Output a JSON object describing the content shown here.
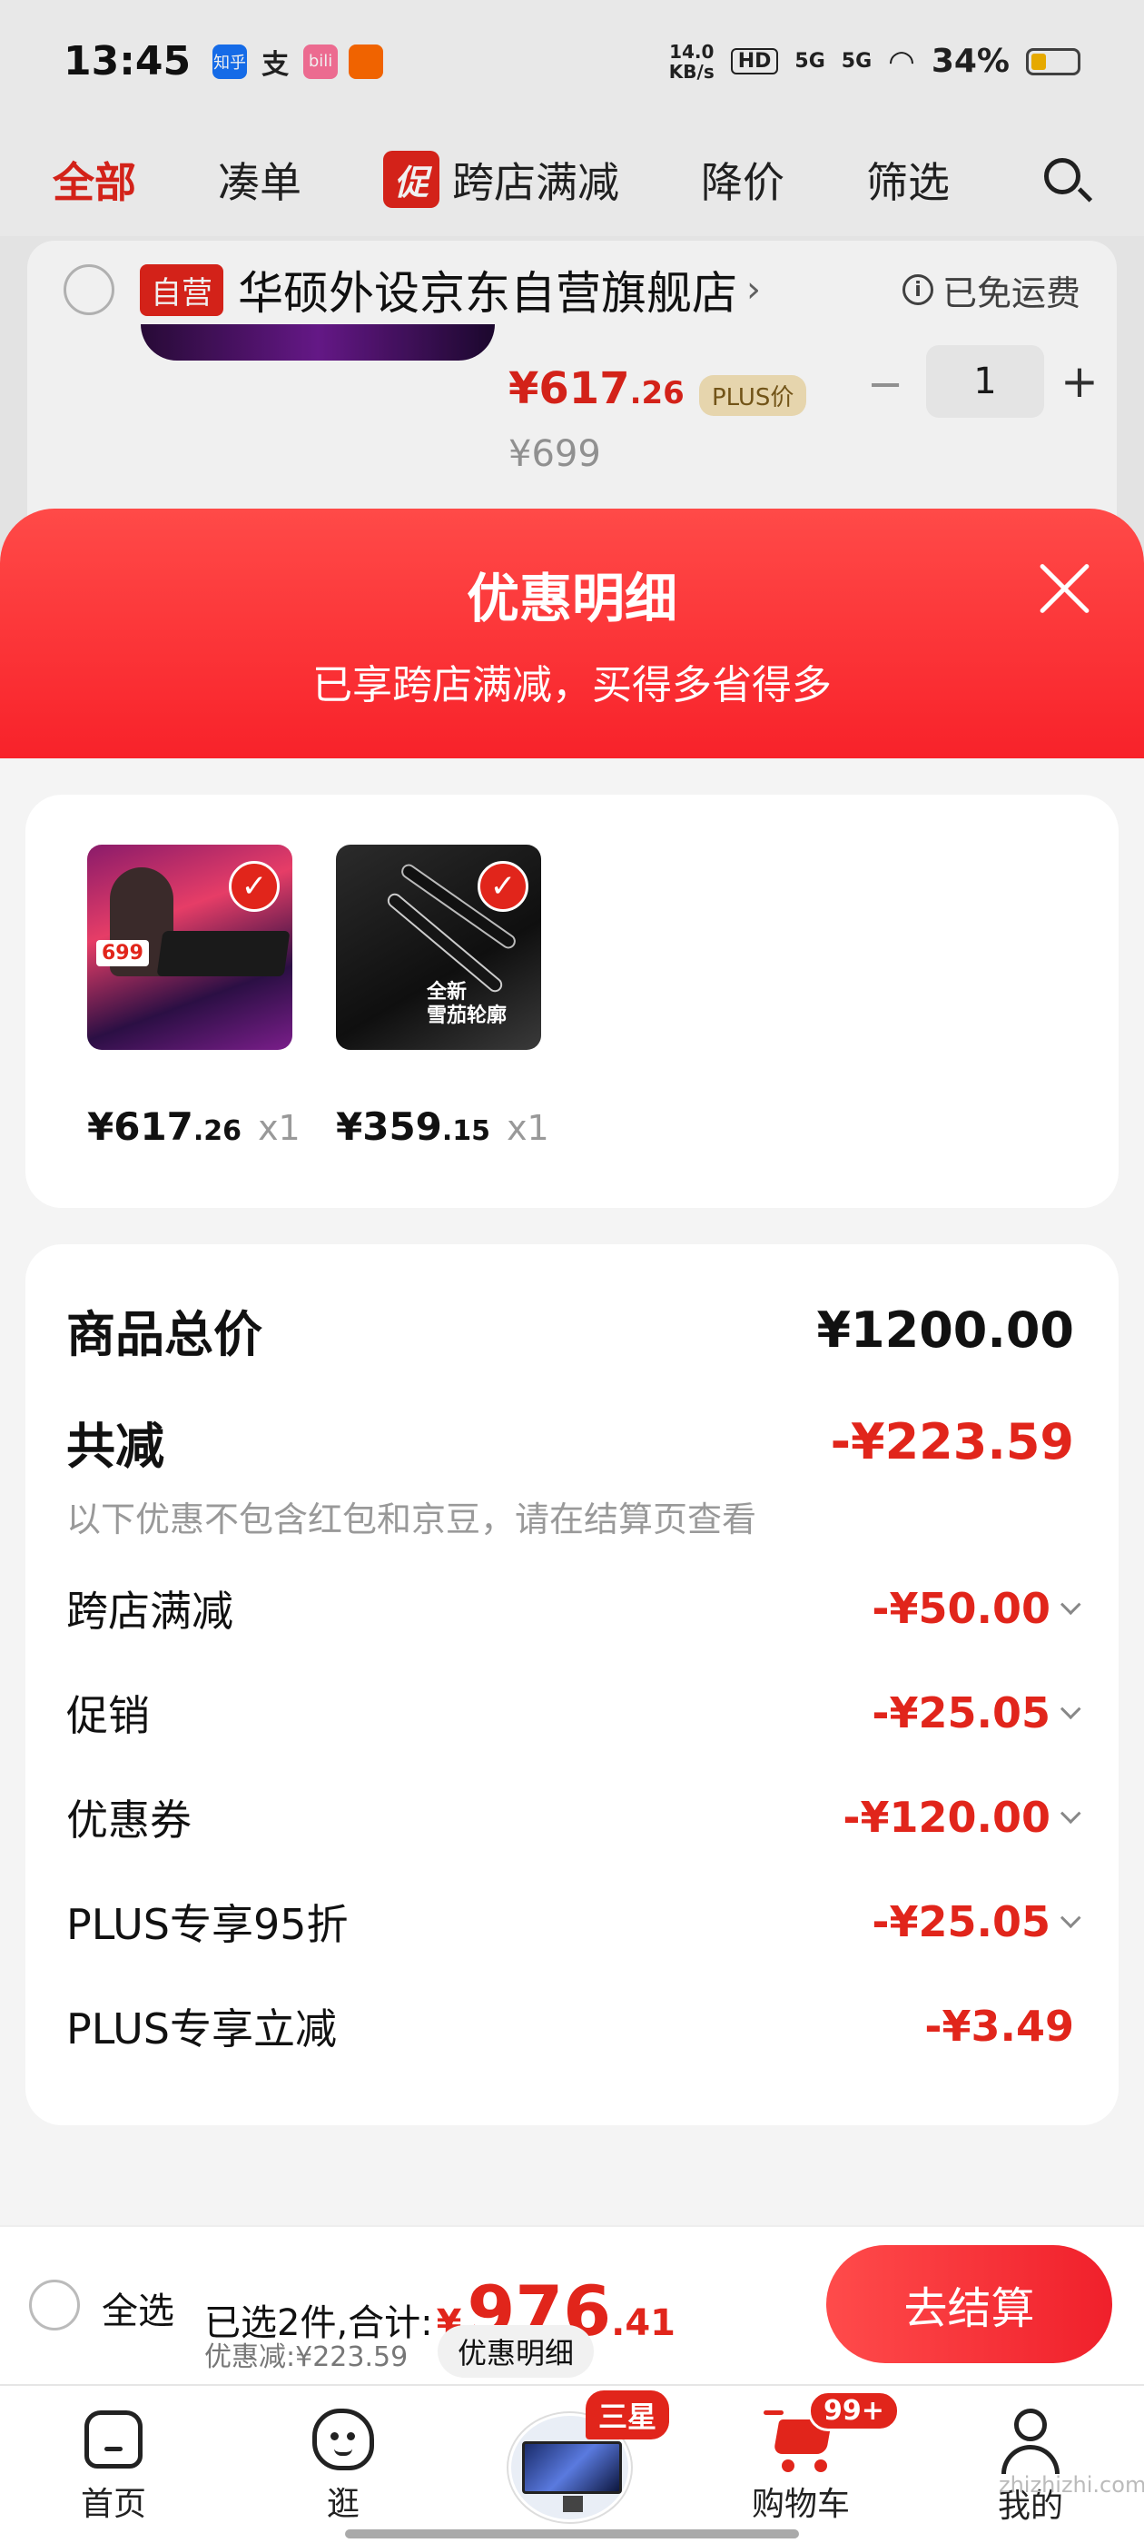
{
  "status_bar": {
    "time": "13:45",
    "apps": [
      {
        "icon": "zhihu-icon",
        "label": "知乎",
        "color": "#1772f6"
      },
      {
        "icon": "alipay-icon",
        "label": "支",
        "color": "#ffffff"
      },
      {
        "icon": "bilibili-icon",
        "label": "bili",
        "color": "#fb7299"
      },
      {
        "icon": "app-icon",
        "label": "",
        "color": "#ff6a00"
      }
    ],
    "net_speed_value": "14.0",
    "net_speed_unit": "KB/s",
    "hd_label": "HD",
    "signal1": "5G",
    "signal2": "5G",
    "battery": "34%",
    "battery_level": 0.34
  },
  "filter_bar": {
    "all": "全部",
    "bundle": "凑单",
    "promo_tag": "促",
    "cross_store": "跨店满减",
    "price_drop": "降价",
    "filter": "筛选"
  },
  "store": {
    "self_badge": "自营",
    "name": "华硕外设京东自营旗舰店",
    "chevron": "›",
    "free_shipping": "已免运费",
    "info": "i",
    "item_price_main": "¥617",
    "item_price_cents": ".26",
    "plus_badge": "PLUS价",
    "qty": "1",
    "qty_minus": "−",
    "qty_plus": "+",
    "orig_price": "¥699"
  },
  "sheet": {
    "title": "优惠明细",
    "subtitle": "已享跨店满减，买得多省得多",
    "products": [
      {
        "price_main": "¥617",
        "price_cents": ".26",
        "qty": "x1",
        "thumb_tag": "699"
      },
      {
        "price_main": "¥359",
        "price_cents": ".15",
        "qty": "x1",
        "thumb_text1": "全新",
        "thumb_text2": "雪茄轮廓"
      }
    ],
    "check_mark": "✓",
    "total_label": "商品总价",
    "total_value": "¥1200.00",
    "reduce_label": "共减",
    "reduce_value": "-¥223.59",
    "note": "以下优惠不包含红包和京豆，请在结算页查看",
    "discounts": [
      {
        "label": "跨店满减",
        "value": "-¥50.00"
      },
      {
        "label": "促销",
        "value": "-¥25.05"
      },
      {
        "label": "优惠券",
        "value": "-¥120.00"
      },
      {
        "label": "PLUS专享95折",
        "value": "-¥25.05"
      },
      {
        "label": "PLUS专享立减",
        "value": "-¥3.49"
      }
    ]
  },
  "checkout": {
    "select_all": "全选",
    "selected": "已选2件,合计:",
    "yen": "¥",
    "total_main": "976",
    "total_cents": ".41",
    "saved": "优惠减:¥223.59",
    "detail_link": "优惠明细",
    "pay_button": "去结算"
  },
  "tabbar": {
    "home": "首页",
    "browse": "逛",
    "samsung_badge": "三星",
    "cart": "购物车",
    "cart_badge": "99+",
    "me": "我的"
  },
  "watermark": "zhizhizhi.com",
  "colors": {
    "accent": "#e1251b",
    "header_gradient_start": "#ff4a48",
    "header_gradient_end": "#f8222a"
  }
}
